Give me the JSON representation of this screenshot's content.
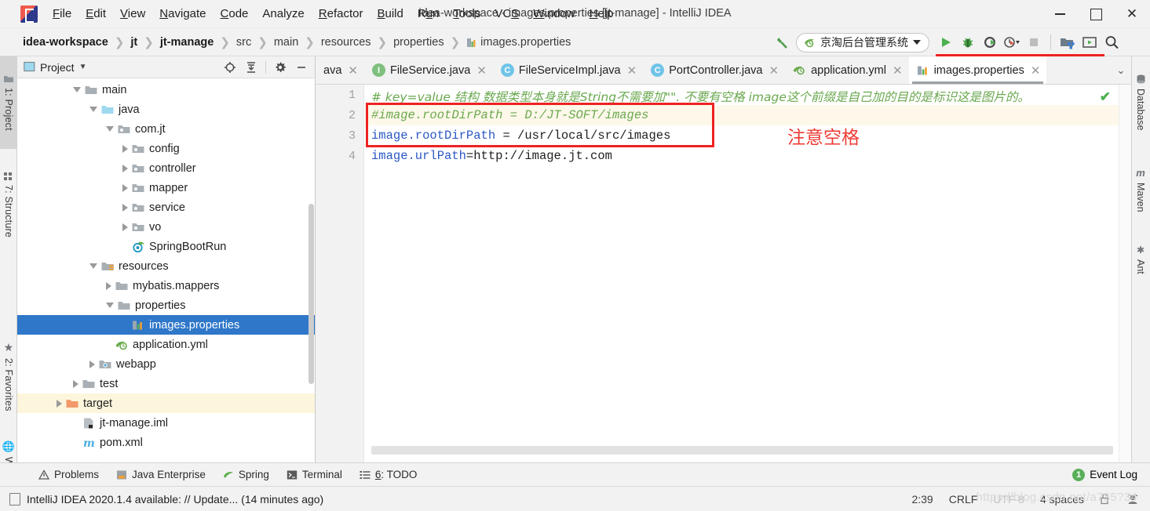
{
  "window": {
    "title": "idea-workspace - images.properties [jt-manage] - IntelliJ IDEA",
    "minimize_label": "",
    "maximize_label": "",
    "close_label": "✕"
  },
  "menu": {
    "items": [
      "File",
      "Edit",
      "View",
      "Navigate",
      "Code",
      "Analyze",
      "Refactor",
      "Build",
      "Run",
      "Tools",
      "VCS",
      "Window",
      "Help"
    ]
  },
  "breadcrumb": {
    "items": [
      {
        "label": "idea-workspace",
        "bold": true,
        "icon": ""
      },
      {
        "label": "jt",
        "bold": true,
        "icon": ""
      },
      {
        "label": "jt-manage",
        "bold": true,
        "icon": ""
      },
      {
        "label": "src",
        "bold": false,
        "icon": ""
      },
      {
        "label": "main",
        "bold": false,
        "icon": ""
      },
      {
        "label": "resources",
        "bold": false,
        "icon": ""
      },
      {
        "label": "properties",
        "bold": false,
        "icon": ""
      },
      {
        "label": "images.properties",
        "bold": false,
        "icon": "properties-file-icon"
      }
    ],
    "separator": "❯"
  },
  "toolbar": {
    "build_icon": "hammer-icon",
    "run_config": "京淘后台管理系统",
    "run_icon": "run-icon",
    "debug_icon": "debug-bug-icon",
    "run_coverage_icon": "run-with-coverage-icon",
    "profiler_icon": "profiler-icon",
    "stop_icon": "stop-icon",
    "project_structure_icon": "project-structure-icon",
    "updates_icon": "update-icon",
    "search_icon": "search-everywhere-icon"
  },
  "left_tool_tabs": [
    {
      "label": "1: Project",
      "icon": "project-folder-icon",
      "selected": true
    },
    {
      "label": "7: Structure",
      "icon": "structure-icon",
      "selected": false
    },
    {
      "label": "2: Favorites",
      "icon": "star-icon",
      "selected": false
    },
    {
      "label": "Web",
      "icon": "web-globe-icon",
      "selected": false
    }
  ],
  "right_tool_tabs": [
    {
      "label": "Database",
      "icon": "database-icon"
    },
    {
      "label": "Maven",
      "icon": "maven-m-icon"
    },
    {
      "label": "Ant",
      "icon": "ant-icon"
    }
  ],
  "project_panel": {
    "title": "Project",
    "dropdown": "▾",
    "actions": [
      "locate-icon",
      "collapse-all-icon",
      "settings-gear-icon",
      "hide-icon"
    ],
    "tree": [
      {
        "label": "main",
        "indent": 3,
        "state": "open",
        "icon": "folder",
        "sel": false,
        "hl": false
      },
      {
        "label": "java",
        "indent": 4,
        "state": "open",
        "icon": "folder-blue",
        "sel": false,
        "hl": false
      },
      {
        "label": "com.jt",
        "indent": 5,
        "state": "open",
        "icon": "folder-src",
        "sel": false,
        "hl": false
      },
      {
        "label": "config",
        "indent": 6,
        "state": "closed",
        "icon": "folder-src",
        "sel": false,
        "hl": false
      },
      {
        "label": "controller",
        "indent": 6,
        "state": "closed",
        "icon": "folder-src",
        "sel": false,
        "hl": false
      },
      {
        "label": "mapper",
        "indent": 6,
        "state": "closed",
        "icon": "folder-src",
        "sel": false,
        "hl": false
      },
      {
        "label": "service",
        "indent": 6,
        "state": "closed",
        "icon": "folder-src",
        "sel": false,
        "hl": false
      },
      {
        "label": "vo",
        "indent": 6,
        "state": "closed",
        "icon": "folder-src",
        "sel": false,
        "hl": false
      },
      {
        "label": "SpringBootRun",
        "indent": 6,
        "state": "leaf",
        "icon": "spring-run",
        "sel": false,
        "hl": false
      },
      {
        "label": "resources",
        "indent": 4,
        "state": "open",
        "icon": "folder-res",
        "sel": false,
        "hl": false
      },
      {
        "label": "mybatis.mappers",
        "indent": 5,
        "state": "closed",
        "icon": "folder",
        "sel": false,
        "hl": false
      },
      {
        "label": "properties",
        "indent": 5,
        "state": "open",
        "icon": "folder",
        "sel": false,
        "hl": false
      },
      {
        "label": "images.properties",
        "indent": 6,
        "state": "leaf",
        "icon": "properties",
        "sel": true,
        "hl": false
      },
      {
        "label": "application.yml",
        "indent": 5,
        "state": "leaf",
        "icon": "yml",
        "sel": false,
        "hl": false
      },
      {
        "label": "webapp",
        "indent": 4,
        "state": "closed",
        "icon": "folder-web",
        "sel": false,
        "hl": false
      },
      {
        "label": "test",
        "indent": 3,
        "state": "closed",
        "icon": "folder",
        "sel": false,
        "hl": false
      },
      {
        "label": "target",
        "indent": 2,
        "state": "closed",
        "icon": "folder-orange",
        "sel": false,
        "hl": true
      },
      {
        "label": "jt-manage.iml",
        "indent": 3,
        "state": "leaf",
        "icon": "iml",
        "sel": false,
        "hl": false
      },
      {
        "label": "pom.xml",
        "indent": 3,
        "state": "leaf",
        "icon": "maven-m",
        "sel": false,
        "hl": false
      }
    ]
  },
  "editor": {
    "tabs": [
      {
        "label": "ava",
        "icon": "none",
        "truncated": true,
        "active": false
      },
      {
        "label": "FileService.java",
        "icon": "interface-i-icon",
        "active": false
      },
      {
        "label": "FileServiceImpl.java",
        "icon": "class-c-icon",
        "active": false
      },
      {
        "label": "PortController.java",
        "icon": "class-c-icon",
        "active": false
      },
      {
        "label": "application.yml",
        "icon": "yml-icon",
        "active": false
      },
      {
        "label": "images.properties",
        "icon": "properties-file-icon",
        "active": true
      }
    ],
    "tab_overflow_icon": "chevron-down-icon",
    "line_numbers": [
      "1",
      "2",
      "3",
      "4"
    ],
    "lines": [
      {
        "n": 1,
        "type": "comment",
        "text": "# key=value 结构  数据类型本身就是String不需要加\"\".  不要有空格    image这个前缀是自己加的目的是标识这是图片的。"
      },
      {
        "n": 2,
        "type": "comment-prop",
        "text": "#image.rootDirPath = D:/JT-SOFT/images"
      },
      {
        "n": 3,
        "type": "property",
        "key": "image.rootDirPath",
        "sep": " = ",
        "value": "/usr/local/src/images"
      },
      {
        "n": 4,
        "type": "property",
        "key": "image.urlPath",
        "sep": "=",
        "value": "http://image.jt.com"
      }
    ],
    "annotation": "注意空格",
    "annotation_color": "#ee3b35",
    "inspection_status": "✔"
  },
  "bottom_tabs": [
    {
      "label": "Problems",
      "icon": "warning-triangle-icon"
    },
    {
      "label": "Java Enterprise",
      "icon": "java-ee-icon"
    },
    {
      "label": "Spring",
      "icon": "spring-leaf-icon"
    },
    {
      "label": "Terminal",
      "icon": "terminal-icon"
    },
    {
      "label": "6: TODO",
      "icon": "todo-list-icon"
    }
  ],
  "event_log": {
    "count": "1",
    "label": "Event Log"
  },
  "status_bar": {
    "message": "IntelliJ IDEA 2020.1.4 available: // Update... (14 minutes ago)",
    "message_icon": "notification-icon",
    "caret_position": "2:39",
    "line_separator": "CRLF",
    "encoding": "UTF-8",
    "indent": "4 spaces",
    "lock_icon": "unlocked-icon",
    "inspection_icon": "hector-icon"
  },
  "watermark": "https://blog.csdn.net/a735?34"
}
